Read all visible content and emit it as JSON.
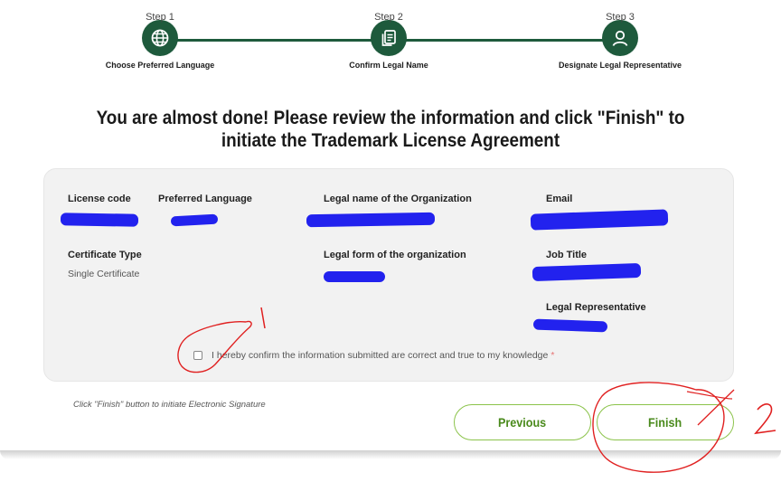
{
  "stepper": {
    "steps": [
      {
        "number_label": "Step 1",
        "title": "Choose Preferred Language",
        "icon": "globe-icon"
      },
      {
        "number_label": "Step 2",
        "title": "Confirm Legal Name",
        "icon": "document-icon"
      },
      {
        "number_label": "Step 3",
        "title": "Designate Legal Representative",
        "icon": "person-icon"
      }
    ],
    "accent_color": "#1e5a3c"
  },
  "heading": {
    "line1": "You are almost done! Please review the information and click \"Finish\" to",
    "line2": "initiate the Trademark License Agreement"
  },
  "summary": {
    "license_code": {
      "label": "License code"
    },
    "preferred_language": {
      "label": "Preferred Language"
    },
    "legal_name": {
      "label": "Legal name of the Organization"
    },
    "email": {
      "label": "Email"
    },
    "certificate_type": {
      "label": "Certificate Type",
      "value": "Single Certificate"
    },
    "legal_form": {
      "label": "Legal form of the organization"
    },
    "job_title": {
      "label": "Job Title"
    },
    "legal_representative": {
      "label": "Legal Representative"
    },
    "redaction_color": "#2222ee"
  },
  "confirmation": {
    "text": "I hereby confirm the information submitted are correct and true to my knowledge",
    "required_mark": "*",
    "checked": false
  },
  "footer": {
    "note": "Click \"Finish\" button to initiate Electronic Signature",
    "previous_label": "Previous",
    "finish_label": "Finish",
    "button_color": "#8bc34a"
  },
  "annotations": {
    "label_1": "1",
    "label_2": "2",
    "color": "#e02020"
  }
}
